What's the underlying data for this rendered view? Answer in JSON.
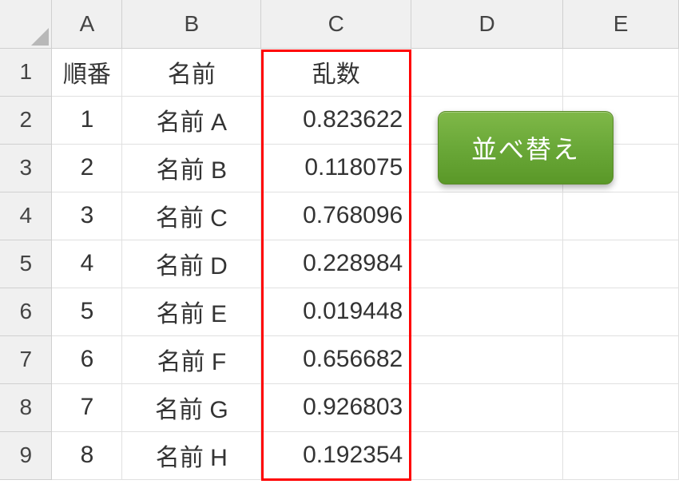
{
  "columns": [
    "A",
    "B",
    "C",
    "D",
    "E"
  ],
  "row_headers": [
    "1",
    "2",
    "3",
    "4",
    "5",
    "6",
    "7",
    "8",
    "9"
  ],
  "headers": {
    "a": "順番",
    "b": "名前",
    "c": "乱数"
  },
  "rows": [
    {
      "order": "1",
      "name": "名前 A",
      "rand": "0.823622"
    },
    {
      "order": "2",
      "name": "名前 B",
      "rand": "0.118075"
    },
    {
      "order": "3",
      "name": "名前 C",
      "rand": "0.768096"
    },
    {
      "order": "4",
      "name": "名前 D",
      "rand": "0.228984"
    },
    {
      "order": "5",
      "name": "名前 E",
      "rand": "0.019448"
    },
    {
      "order": "6",
      "name": "名前 F",
      "rand": "0.656682"
    },
    {
      "order": "7",
      "name": "名前 G",
      "rand": "0.926803"
    },
    {
      "order": "8",
      "name": "名前 H",
      "rand": "0.192354"
    }
  ],
  "button": {
    "sort_label": "並べ替え"
  }
}
